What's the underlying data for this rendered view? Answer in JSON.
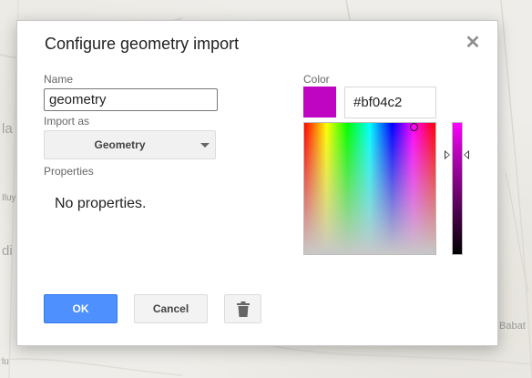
{
  "map": {
    "labels": [
      "la",
      "di",
      "Iluy",
      "Babat",
      "lu"
    ]
  },
  "dialog": {
    "title": "Configure geometry import",
    "close_icon": "close-icon",
    "name": {
      "label": "Name",
      "value": "geometry"
    },
    "import_as": {
      "label": "Import as",
      "selected": "Geometry"
    },
    "properties": {
      "label": "Properties",
      "empty_text": "No properties."
    },
    "color": {
      "label": "Color",
      "hex": "#bf04c2",
      "swatch_color": "#bf04c2"
    },
    "buttons": {
      "ok": "OK",
      "cancel": "Cancel",
      "delete_icon": "trash-icon"
    }
  }
}
